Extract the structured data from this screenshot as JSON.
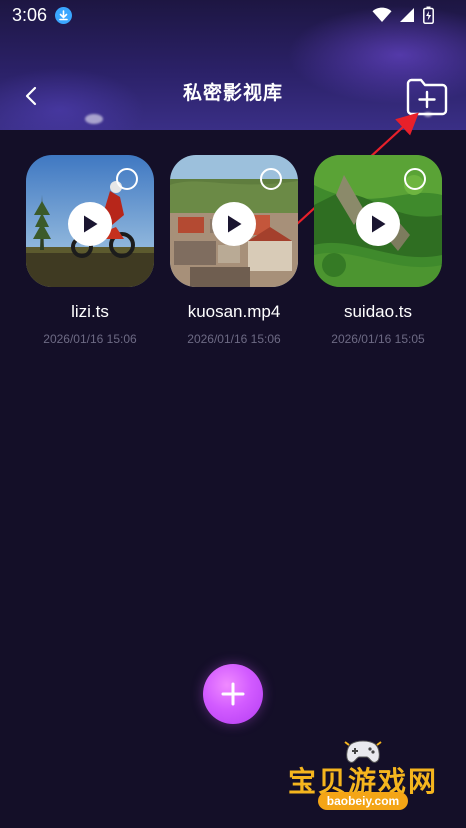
{
  "status_bar": {
    "time": "3:06"
  },
  "header": {
    "title": "私密影视库"
  },
  "videos": [
    {
      "name": "lizi.ts",
      "date": "2026/01/16 15:06"
    },
    {
      "name": "kuosan.mp4",
      "date": "2026/01/16 15:06"
    },
    {
      "name": "suidao.ts",
      "date": "2026/01/16 15:05"
    }
  ],
  "watermark": {
    "text": "宝贝游戏网",
    "url": "baobeiy.com"
  },
  "colors": {
    "background": "#140f28",
    "fab_accent": "#d25bff",
    "annotation_arrow": "#e8202a",
    "date_text": "#6d6a84"
  },
  "icons": {
    "back": "chevron-left-icon",
    "add_folder": "folder-plus-icon",
    "play": "play-icon",
    "select": "selection-circle-icon",
    "fab": "plus-icon"
  }
}
